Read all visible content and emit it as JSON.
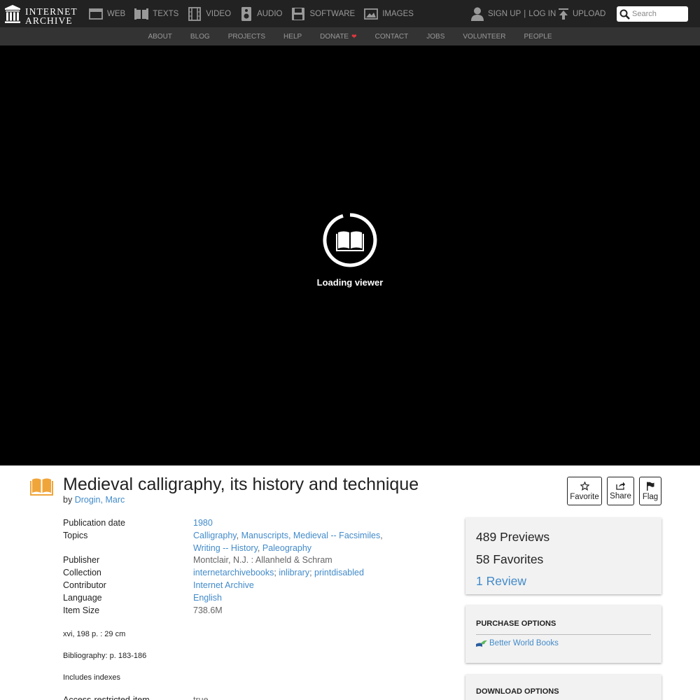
{
  "brand": {
    "line1": "INTERNET",
    "line2": "ARCHIVE",
    "icon": "temple-icon"
  },
  "media_nav": [
    {
      "label": "WEB",
      "icon": "web-icon"
    },
    {
      "label": "TEXTS",
      "icon": "book-icon"
    },
    {
      "label": "VIDEO",
      "icon": "film-icon"
    },
    {
      "label": "AUDIO",
      "icon": "speaker-icon"
    },
    {
      "label": "SOFTWARE",
      "icon": "floppy-icon"
    },
    {
      "label": "IMAGES",
      "icon": "image-icon"
    }
  ],
  "user": {
    "signup": "SIGN UP",
    "separator": "|",
    "login": "LOG IN",
    "upload": "UPLOAD"
  },
  "search": {
    "placeholder": "Search"
  },
  "subnav": [
    "ABOUT",
    "BLOG",
    "PROJECTS",
    "HELP",
    "DONATE",
    "CONTACT",
    "JOBS",
    "VOLUNTEER",
    "PEOPLE"
  ],
  "viewer": {
    "loading": "Loading viewer"
  },
  "item": {
    "title": "Medieval calligraphy, its history and technique",
    "by_label": "by",
    "author": "Drogin, Marc"
  },
  "actions": {
    "favorite": "Favorite",
    "share": "Share",
    "flag": "Flag"
  },
  "metadata": {
    "publication_date": {
      "key": "Publication date",
      "value": "1980"
    },
    "topics": {
      "key": "Topics",
      "values": [
        "Calligraphy",
        "Manuscripts, Medieval -- Facsimiles",
        "Writing -- History",
        "Paleography"
      ]
    },
    "publisher": {
      "key": "Publisher",
      "value": "Montclair, N.J. : Allanheld & Schram"
    },
    "collection": {
      "key": "Collection",
      "values": [
        "internetarchivebooks",
        "inlibrary",
        "printdisabled"
      ]
    },
    "contributor": {
      "key": "Contributor",
      "value": "Internet Archive"
    },
    "language": {
      "key": "Language",
      "value": "English"
    },
    "item_size": {
      "key": "Item Size",
      "value": "738.6M"
    },
    "notes": [
      "xvi, 198 p. : 29 cm",
      "Bibliography: p. 183-186",
      "Includes indexes"
    ],
    "access": {
      "key": "Access-restricted-item",
      "value": "true"
    }
  },
  "stats": {
    "previews_count": "489",
    "previews_label": "Previews",
    "favorites_count": "58",
    "favorites_label": "Favorites",
    "reviews_count": "1",
    "reviews_label": "Review"
  },
  "purchase": {
    "heading": "PURCHASE OPTIONS",
    "vendor": "Better World Books"
  },
  "download": {
    "heading": "DOWNLOAD OPTIONS"
  },
  "colors": {
    "topbar": "#222222",
    "subnav": "#333333",
    "link": "#428bca",
    "icon_orange": "#f0a53a",
    "heart": "#e0383e"
  }
}
